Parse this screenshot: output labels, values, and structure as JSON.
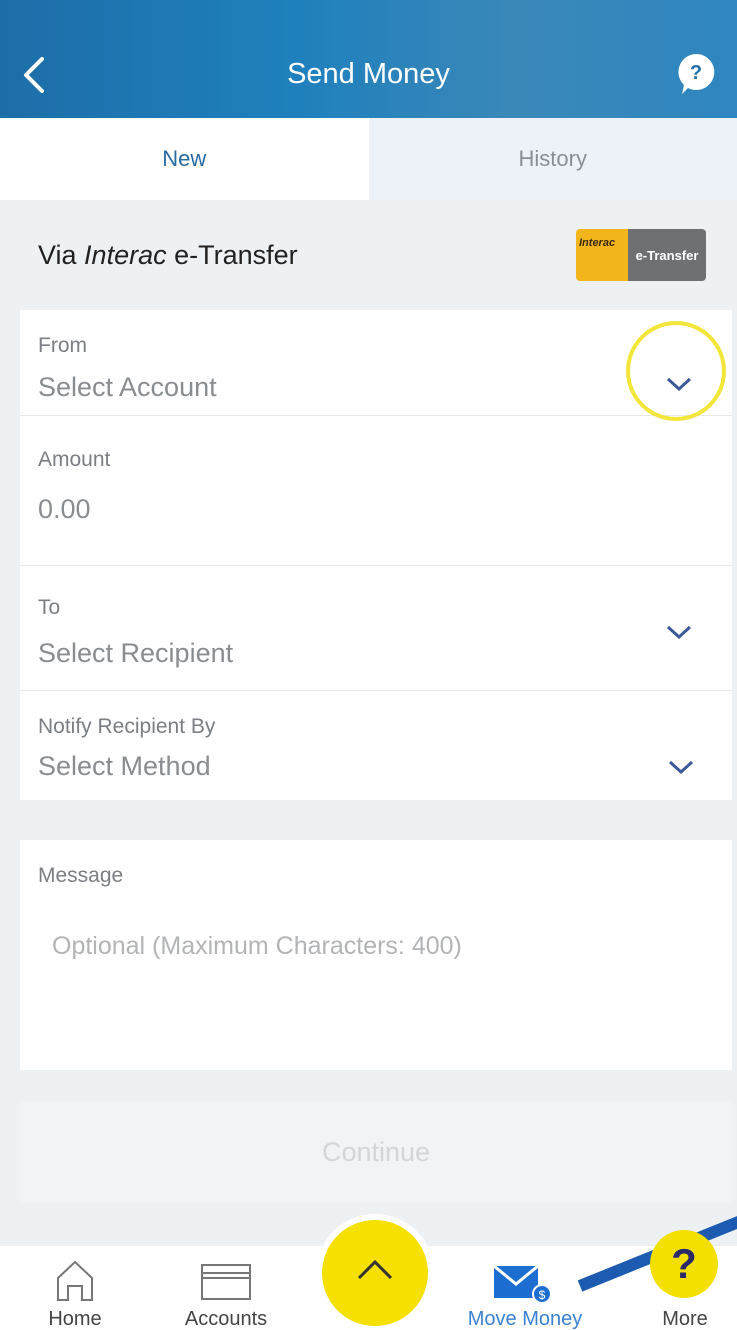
{
  "header": {
    "title": "Send Money"
  },
  "tabs": [
    {
      "label": "New",
      "active": true
    },
    {
      "label": "History",
      "active": false
    }
  ],
  "via": {
    "prefix": "Via ",
    "brand": "Interac",
    "suffix": " e-Transfer",
    "logo": {
      "left_text": "Interac",
      "right_text": "e-Transfer"
    }
  },
  "form": {
    "from": {
      "label": "From",
      "value": "Select Account"
    },
    "amount": {
      "label": "Amount",
      "value": "0.00"
    },
    "to": {
      "label": "To",
      "value": "Select Recipient"
    },
    "notify": {
      "label": "Notify Recipient By",
      "value": "Select Method"
    },
    "message": {
      "label": "Message",
      "placeholder": "Optional (Maximum Characters: 400)"
    }
  },
  "continue_label": "Continue",
  "bottom_nav": [
    {
      "label": "Home",
      "icon": "home-icon"
    },
    {
      "label": "Accounts",
      "icon": "card-icon"
    },
    {
      "label": "",
      "icon": "chevron-up-icon"
    },
    {
      "label": "Move Money",
      "icon": "envelope-dollar-icon",
      "active": true
    },
    {
      "label": "More",
      "icon": "more-icon"
    }
  ],
  "help_bubble": "?",
  "colors": {
    "header": "#1f80bd",
    "active_tab": "#2a6aa0",
    "chevron": "#3b5a9a",
    "fab": "#f5e000",
    "highlight": "#f3e63a"
  }
}
